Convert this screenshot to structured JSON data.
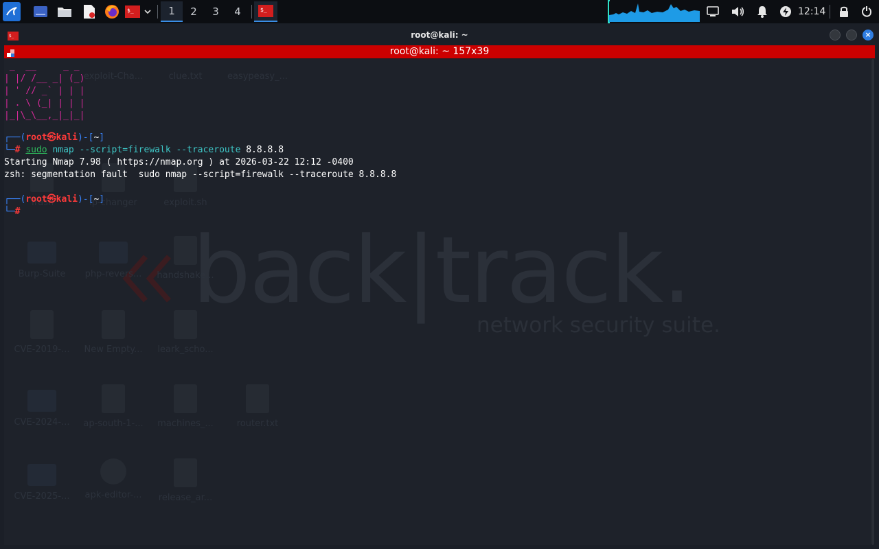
{
  "panel": {
    "workspaces": [
      "1",
      "2",
      "3",
      "4"
    ],
    "active_workspace": "1",
    "clock": "12:14",
    "colors": {
      "accent": "#3a8ee6",
      "graph": "#1e9be6"
    }
  },
  "window": {
    "title": "root@kali: ~",
    "tab_title": "root@kali: ~ 157x39",
    "tab_color": "#cc0000"
  },
  "terminal": {
    "ascii_art": [
      " _  __     _ _ ",
      "| |/ /__ _| (_)",
      "| ' // _` | | |",
      "| . \\ (_| | | |",
      "|_|\\_\\__,_|_|_|"
    ],
    "prompt1": {
      "user": "root",
      "at": "㉿",
      "host": "kali",
      "dir": "~",
      "symbol": "#"
    },
    "command": {
      "sudo": "sudo",
      "nmap": "nmap",
      "args": "--script=firewalk --traceroute",
      "target": "8.8.8.8"
    },
    "output": [
      "Starting Nmap 7.98 ( https://nmap.org ) at 2026-03-22 12:12 -0400",
      "zsh: segmentation fault  sudo nmap --script=firewalk --traceroute 8.8.8.8"
    ],
    "prompt2": {
      "user": "root",
      "at": "㉿",
      "host": "kali",
      "dir": "~",
      "symbol": "#"
    }
  },
  "desktop": {
    "wallpaper_text": "back|track.",
    "wallpaper_subtext": "network security suite.",
    "icons": [
      [
        "exploit-Cha...",
        "clue.txt",
        "easypeasy_..."
      ],
      [
        "Trash",
        "ip-changer",
        "exploit.sh"
      ],
      [
        "Burp-Suite",
        "php-revers...",
        "handshake..."
      ],
      [
        "CVE-2019-...",
        "New Empty...",
        "leark_scho..."
      ],
      [
        "CVE-2024-...",
        "ap-south-1-...",
        "machines_...",
        "router.txt"
      ],
      [
        "CVE-2025-...",
        "apk-editor-...",
        "release_ar..."
      ]
    ]
  }
}
